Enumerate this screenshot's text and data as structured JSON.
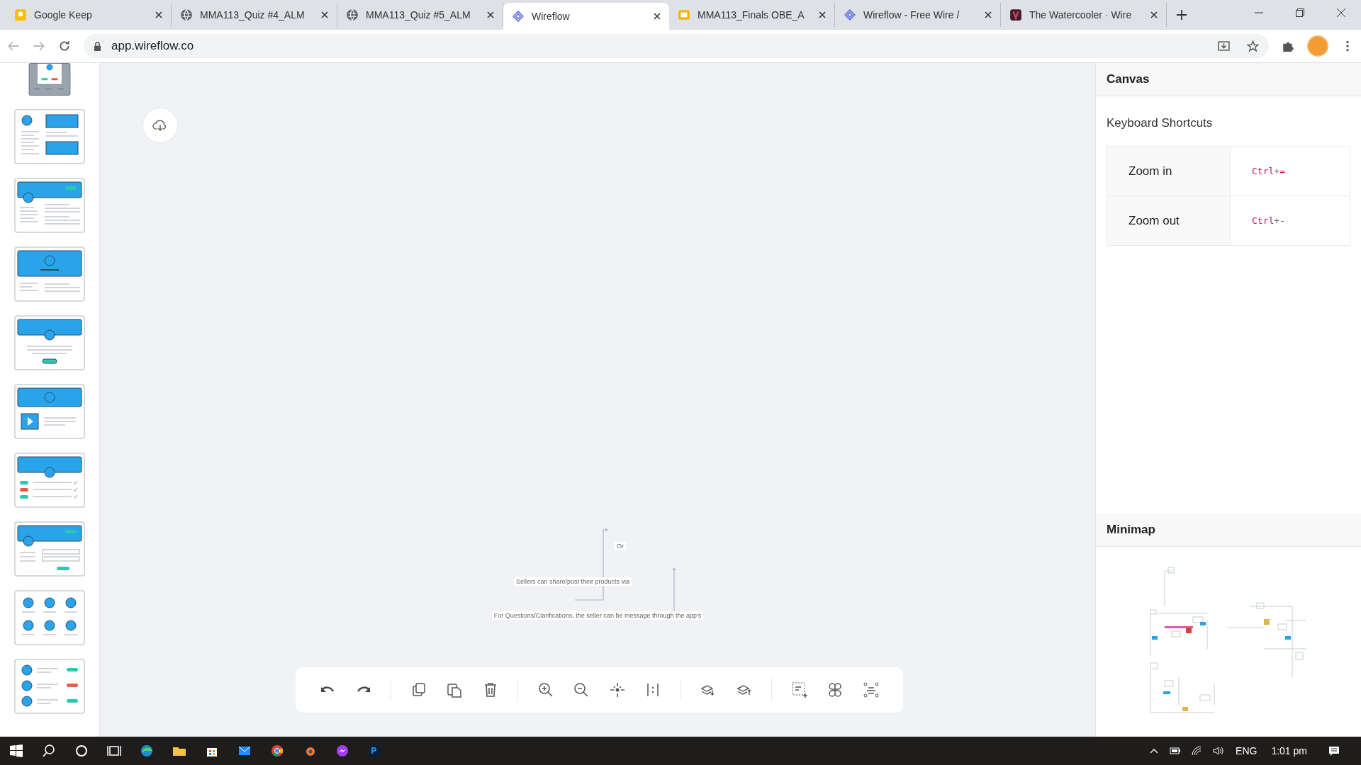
{
  "browser": {
    "tabs": [
      {
        "title": "Google Keep",
        "selected": false
      },
      {
        "title": "MMA113_Quiz #4_ALM",
        "selected": false
      },
      {
        "title": "MMA113_Quiz #5_ALM",
        "selected": false
      },
      {
        "title": "Wireflow",
        "selected": true
      },
      {
        "title": "MMA113_Finals OBE_A",
        "selected": false
      },
      {
        "title": "Wireflow - Free Wire /",
        "selected": false
      },
      {
        "title": "The Watercooler · Wire",
        "selected": false
      }
    ],
    "url": "app.wireflow.co"
  },
  "templates": [
    {
      "kind": "dialog"
    },
    {
      "kind": "profile-images"
    },
    {
      "kind": "banner-left"
    },
    {
      "kind": "banner-center"
    },
    {
      "kind": "banner-button"
    },
    {
      "kind": "video"
    },
    {
      "kind": "checklist"
    },
    {
      "kind": "form"
    },
    {
      "kind": "grid"
    },
    {
      "kind": "list"
    }
  ],
  "canvas": {
    "nodes": [
      {
        "text": "Or"
      },
      {
        "text": "Sellers can share/post their products via"
      },
      {
        "text": "For Questions/Clarifications, the seller can be message through the app's"
      }
    ]
  },
  "panel": {
    "title": "Canvas",
    "shortcuts_heading": "Keyboard Shortcuts",
    "shortcuts": [
      {
        "action": "Zoom in",
        "keys": [
          "Ctrl",
          "+",
          "="
        ]
      },
      {
        "action": "Zoom out",
        "keys": [
          "Ctrl",
          "+",
          "-"
        ]
      }
    ],
    "minimap_heading": "Minimap"
  },
  "taskbar": {
    "language": "ENG",
    "time": "1:01 pm"
  }
}
